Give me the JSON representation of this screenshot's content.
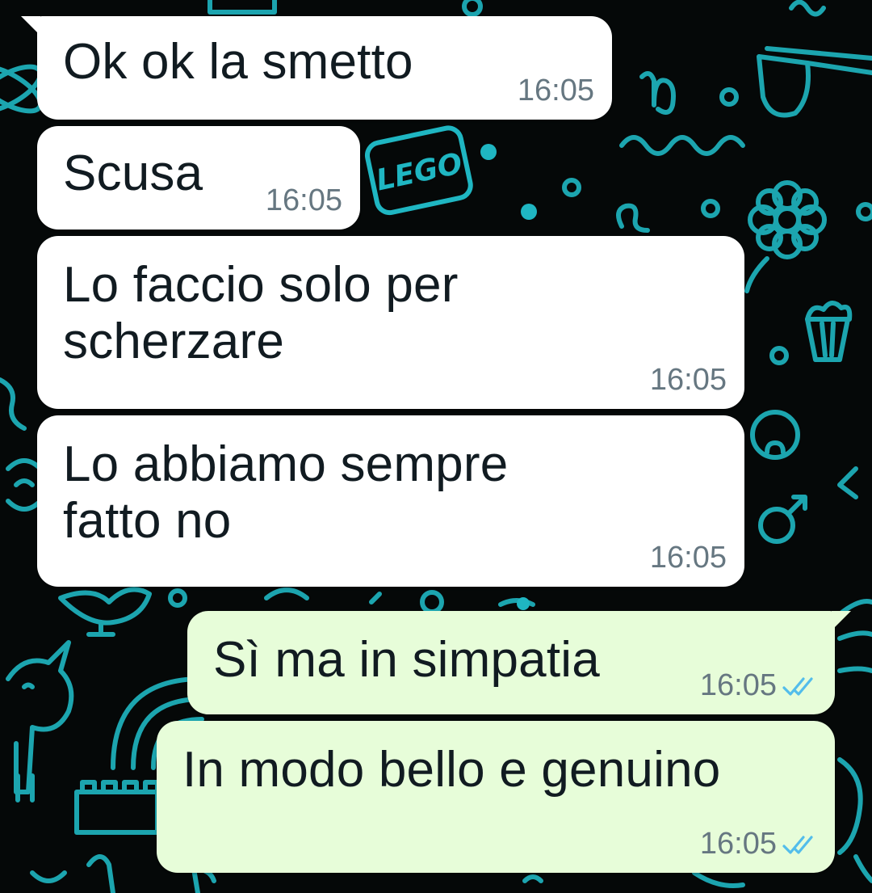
{
  "chat": {
    "messages": [
      {
        "direction": "incoming",
        "text": "Ok ok la smetto",
        "time": "16:05"
      },
      {
        "direction": "incoming",
        "text": "Scusa",
        "time": "16:05"
      },
      {
        "direction": "incoming",
        "text": "Lo faccio solo per\nscherzare",
        "time": "16:05"
      },
      {
        "direction": "incoming",
        "text": "Lo abbiamo sempre\nfatto no",
        "time": "16:05"
      },
      {
        "direction": "outgoing",
        "text": "Sì ma in simpatia",
        "time": "16:05",
        "status": "read"
      },
      {
        "direction": "outgoing",
        "text": "In modo bello e genuino",
        "time": "16:05",
        "status": "read"
      }
    ]
  },
  "wallpaper": {
    "doodles": [
      "lego-icon",
      "flower-icon",
      "sunglasses-icon",
      "github-icon",
      "popcorn-icon",
      "unicorn-icon",
      "rainbow-icon",
      "male-symbol-icon",
      "capricorn-symbol-icon",
      "leo-symbol-icon"
    ],
    "logo_text": "LEGO"
  },
  "colors": {
    "background": "#050808",
    "doodle": "#1fb6c2",
    "incoming_bubble": "#ffffff",
    "outgoing_bubble": "#e7fdd9",
    "text": "#111b21",
    "timestamp": "#667781",
    "read_ticks": "#53bdeb"
  }
}
